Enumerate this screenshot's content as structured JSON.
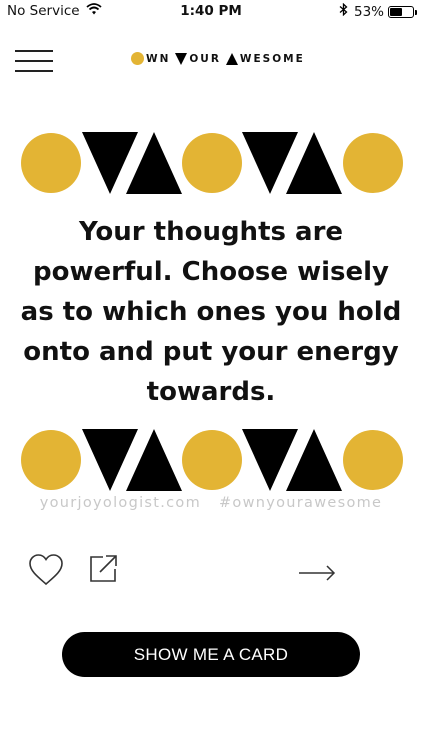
{
  "status_bar": {
    "carrier": "No Service",
    "time": "1:40 PM",
    "battery_percent": "53%",
    "battery_level": 0.53,
    "icons": [
      "wifi-icon",
      "bluetooth-icon",
      "battery-icon"
    ]
  },
  "header": {
    "menu_icon": "hamburger-menu-icon",
    "brand": {
      "part1": "WN",
      "part2": "OUR",
      "part3": "WESOME"
    }
  },
  "card": {
    "quote": "Your thoughts are powerful. Choose wisely as to which ones you hold onto and put your energy towards.",
    "website": "yourjoyologist.com",
    "hashtag": "#ownyourawesome",
    "colors": {
      "gold": "#e3b434",
      "black": "#000000"
    },
    "pattern": [
      "circle",
      "triangle-down",
      "triangle-up",
      "circle",
      "triangle-down",
      "triangle-up",
      "circle"
    ]
  },
  "actions": {
    "like_icon": "heart-icon",
    "share_icon": "share-icon",
    "next_icon": "arrow-right-icon",
    "show_card_label": "SHOW ME A CARD"
  }
}
